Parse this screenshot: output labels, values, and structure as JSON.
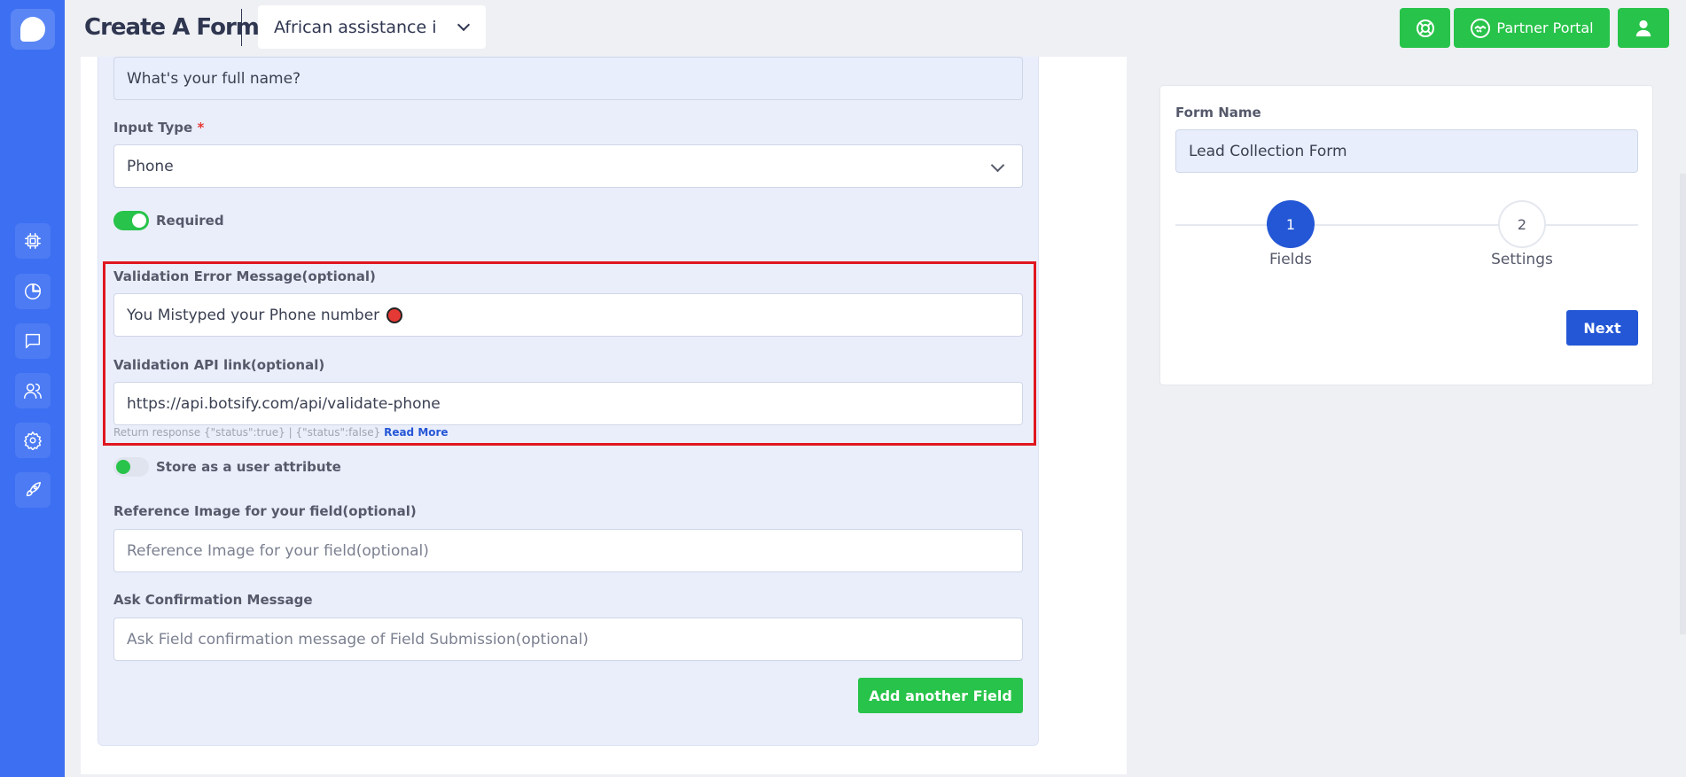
{
  "header": {
    "title": "Create A Form",
    "bot_selector_value": "African assistance i",
    "support_icon": "lifebuoy-icon",
    "partner_portal_label": "Partner Portal",
    "user_icon": "user-icon"
  },
  "sidebar": {
    "items": [
      {
        "icon": "chip-icon"
      },
      {
        "icon": "pie-chart-icon"
      },
      {
        "icon": "chat-icon"
      },
      {
        "icon": "users-icon"
      },
      {
        "icon": "gear-icon"
      },
      {
        "icon": "rocket-icon"
      }
    ]
  },
  "field": {
    "question_value": "What's your full name?",
    "input_type_label": "Input Type",
    "input_type_required_mark": "*",
    "input_type_value": "Phone",
    "required_label": "Required",
    "validation_error_label": "Validation Error Message(optional)",
    "validation_error_value": "You Mistyped your Phone number",
    "validation_api_label": "Validation API link(optional)",
    "validation_api_value": "https://api.botsify.com/api/validate-phone",
    "hint_text": "Return response {\"status\":true} | {\"status\":false}",
    "hint_link": "Read More",
    "store_attribute_label": "Store as a user attribute",
    "reference_image_label": "Reference Image for your field(optional)",
    "reference_image_placeholder": "Reference Image for your field(optional)",
    "confirmation_label": "Ask Confirmation Message",
    "confirmation_placeholder": "Ask Field confirmation message of Field Submission(optional)",
    "add_field_label": "Add another Field"
  },
  "right_panel": {
    "form_name_label": "Form Name",
    "form_name_value": "Lead Collection Form",
    "steps": [
      {
        "number": "1",
        "label": "Fields"
      },
      {
        "number": "2",
        "label": "Settings"
      }
    ],
    "next_label": "Next"
  },
  "colors": {
    "sidebar": "#3d6ff2",
    "green": "#28c34a",
    "primary_blue": "#2457d6",
    "highlight_red": "#e0161f"
  }
}
